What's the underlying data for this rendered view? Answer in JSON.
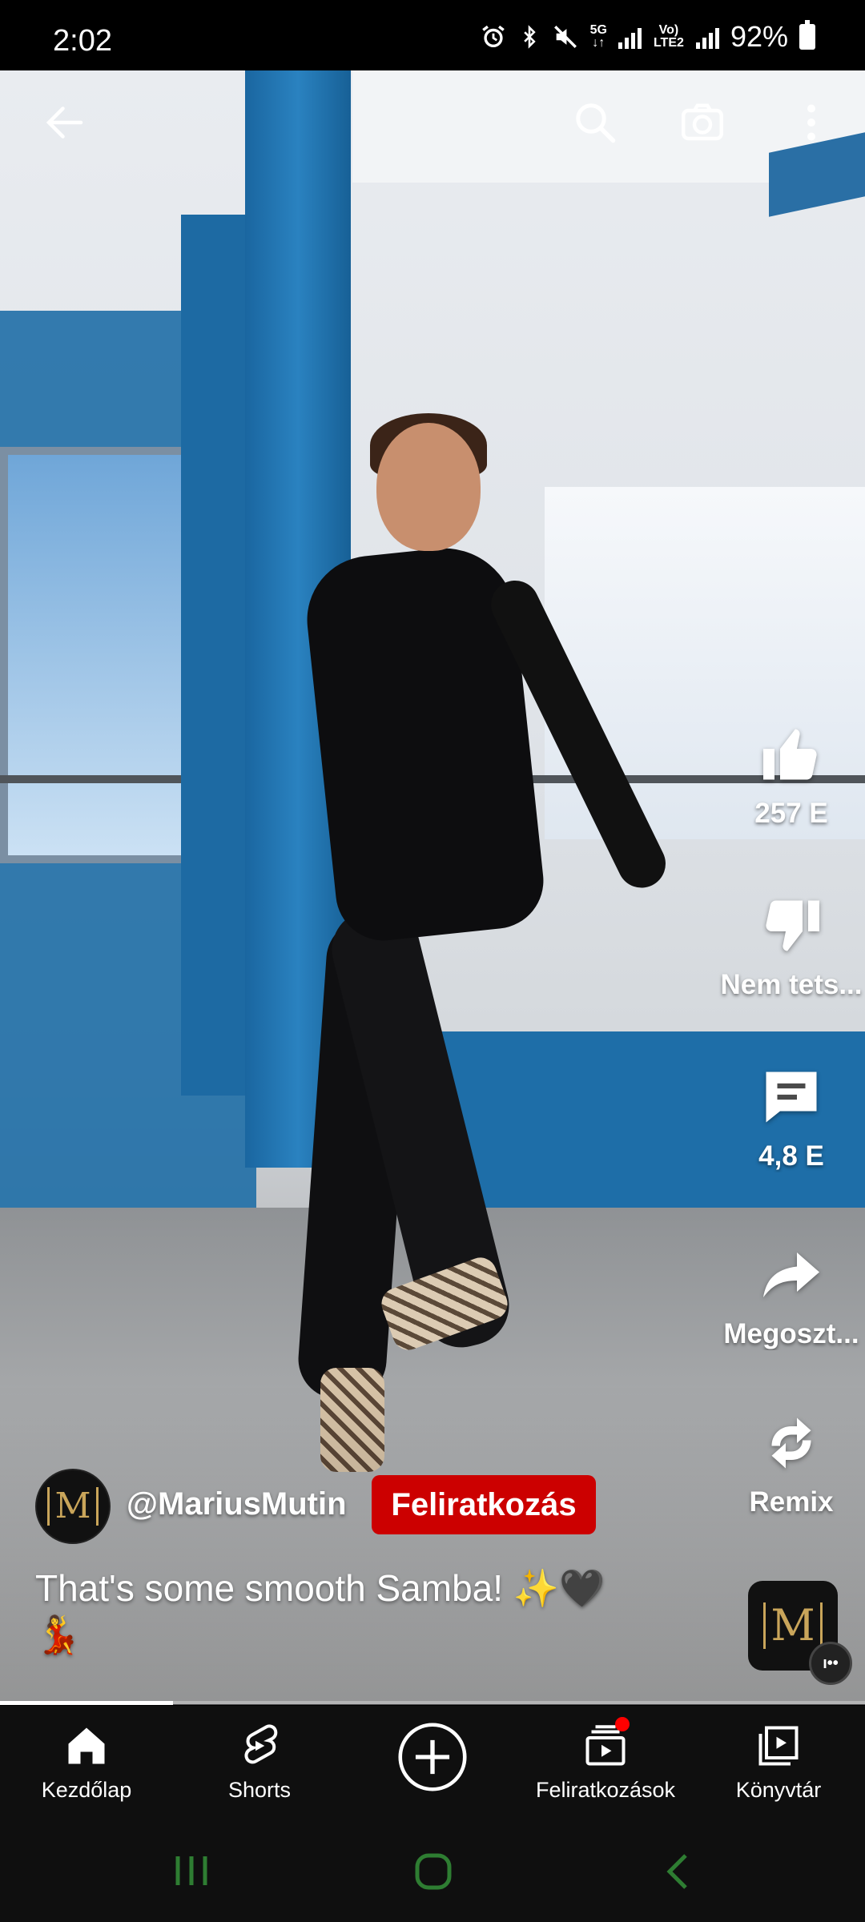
{
  "status_bar": {
    "time": "2:02",
    "network": "5G",
    "volte": "Vo) LTE2",
    "battery": "92%",
    "icons": [
      "alarm-icon",
      "bluetooth-icon",
      "mute-icon",
      "signal-icon",
      "battery-icon"
    ]
  },
  "top_bar": {
    "icons": [
      "back-arrow-icon",
      "search-icon",
      "camera-icon",
      "more-vert-icon"
    ]
  },
  "actions": {
    "like_count": "257 E",
    "dislike_label": "Nem tets...",
    "comment_count": "4,8 E",
    "share_label": "Megoszt...",
    "remix_label": "Remix"
  },
  "channel": {
    "avatar_letter": "M",
    "handle": "@MariusMutin",
    "subscribe_label": "Feliratkozás"
  },
  "caption": {
    "text": "That's some smooth Samba! ✨🖤",
    "emoji_line": "💃"
  },
  "music_thumb": {
    "letter": "M",
    "badge": "ı••"
  },
  "progress": {
    "fraction": 0.2
  },
  "bottom_nav": {
    "items": [
      {
        "label": "Kezdőlap",
        "icon": "home-icon"
      },
      {
        "label": "Shorts",
        "icon": "shorts-icon"
      },
      {
        "label": "",
        "icon": "create-plus-icon"
      },
      {
        "label": "Feliratkozások",
        "icon": "subscriptions-icon"
      },
      {
        "label": "Könyvtár",
        "icon": "library-icon"
      }
    ]
  },
  "colors": {
    "accent_red": "#cc0000",
    "nav_bg": "#0f0f0f",
    "system_nav_green": "#2e7d32"
  }
}
